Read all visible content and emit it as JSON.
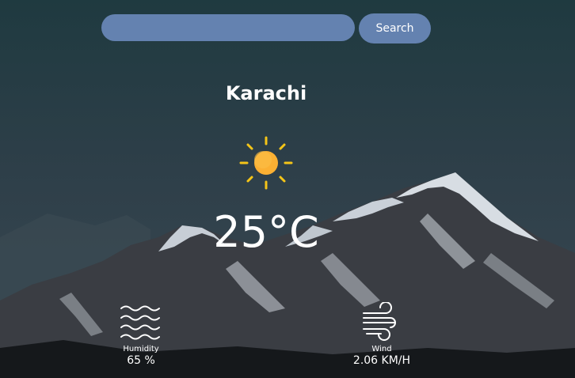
{
  "search": {
    "value": "",
    "placeholder": "",
    "button_label": "Search"
  },
  "weather": {
    "city": "Karachi",
    "temperature": "25°C",
    "condition_icon": "sun-icon"
  },
  "stats": {
    "humidity": {
      "label": "Humidity",
      "value": "65 %",
      "icon": "waves-icon"
    },
    "wind": {
      "label": "Wind",
      "value": "2.06 KM/H",
      "icon": "wind-icon"
    }
  },
  "colors": {
    "accent": "#6482b0",
    "sun": "#fbb033",
    "sun_rays": "#f5c518",
    "text": "#ffffff"
  }
}
